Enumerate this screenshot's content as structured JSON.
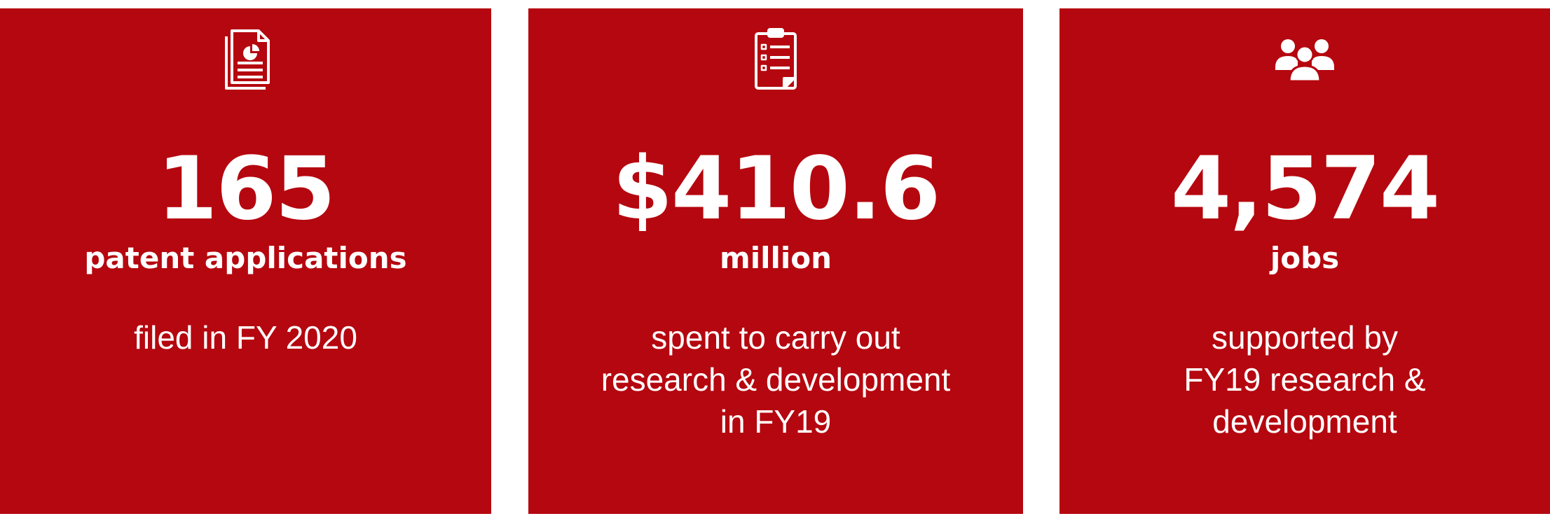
{
  "colors": {
    "card_background": "#b5070f",
    "text": "#ffffff",
    "page_background": "#ffffff"
  },
  "stats": [
    {
      "icon": "document-chart-icon",
      "value": "165",
      "unit": "patent applications",
      "description": [
        "filed in FY 2020"
      ]
    },
    {
      "icon": "clipboard-checklist-icon",
      "value": "$410.6",
      "unit": "million",
      "description": [
        "spent to carry out",
        "research & development",
        "in FY19"
      ]
    },
    {
      "icon": "people-group-icon",
      "value": "4,574",
      "unit": "jobs",
      "description": [
        "supported by",
        "FY19 research &",
        "development"
      ]
    }
  ]
}
